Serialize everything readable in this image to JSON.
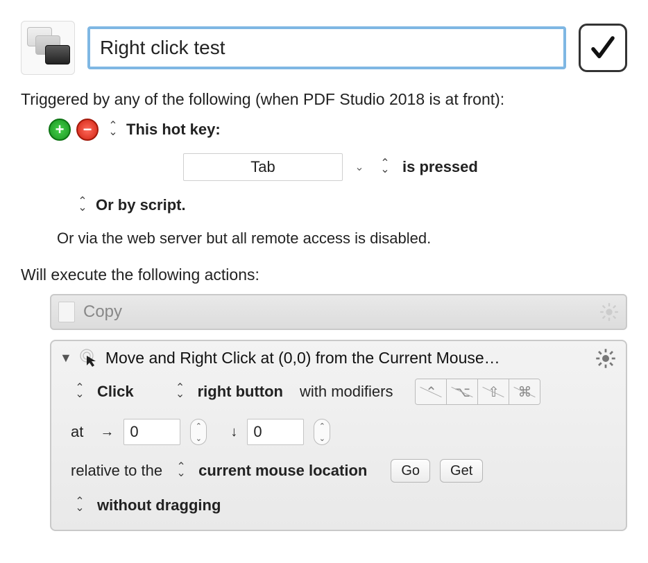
{
  "header": {
    "macro_name": "Right click test"
  },
  "triggers": {
    "heading": "Triggered by any of the following (when PDF Studio 2018 is at front):",
    "hotkey_label": "This hot key:",
    "hotkey_value": "Tab",
    "hotkey_state": "is pressed",
    "or_script": "Or by script.",
    "or_web": "Or via the web server but all remote access is disabled."
  },
  "exec": {
    "heading": "Will execute the following actions:"
  },
  "copy_bar": {
    "label": "Copy"
  },
  "action": {
    "title": "Move and Right Click at (0,0) from the Current Mouse…",
    "click_type": "Click",
    "button": "right button",
    "with_modifiers": "with modifiers",
    "at_label": "at",
    "x": "0",
    "y": "0",
    "relative_label": "relative to the",
    "relative_value": "current mouse location",
    "go": "Go",
    "get": "Get",
    "drag": "without dragging"
  }
}
